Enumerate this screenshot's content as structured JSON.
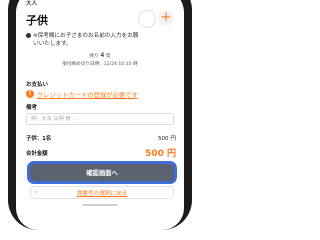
{
  "header": {
    "top_label": "大人"
  },
  "child": {
    "title": "子供",
    "minus_icon": "minus-icon",
    "plus_icon": "plus-icon",
    "plus_glyph": "+"
  },
  "note": {
    "text_line1": "※保考欄にお子さまのお名前の入力をお願",
    "text_line2": "いいたします。"
  },
  "meta": {
    "count_prefix": "残り",
    "count_value": "4",
    "count_suffix": "席",
    "deadline": "受付締め切り日時：12/24 10:10 時"
  },
  "payment": {
    "label": "お支払い",
    "link_text": "クレジットカードの登録が必要です",
    "icon": "alert-icon",
    "icon_glyph": "!"
  },
  "memo": {
    "label": "備考",
    "placeholder": "例）大本 弘明 様 …"
  },
  "pricing": {
    "child_label": "子供：1名",
    "child_price": "500 円",
    "total_label": "合計金額",
    "total_price": "500 円"
  },
  "actions": {
    "confirm_label": "確認画面へ",
    "back_label": "席番号の選択に戻る",
    "back_icon": "chevron-left-icon",
    "back_glyph": "‹"
  },
  "colors": {
    "accent": "#ff7a1a",
    "primary_button": "#5c6270",
    "focus_ring": "#3f6ed6"
  }
}
